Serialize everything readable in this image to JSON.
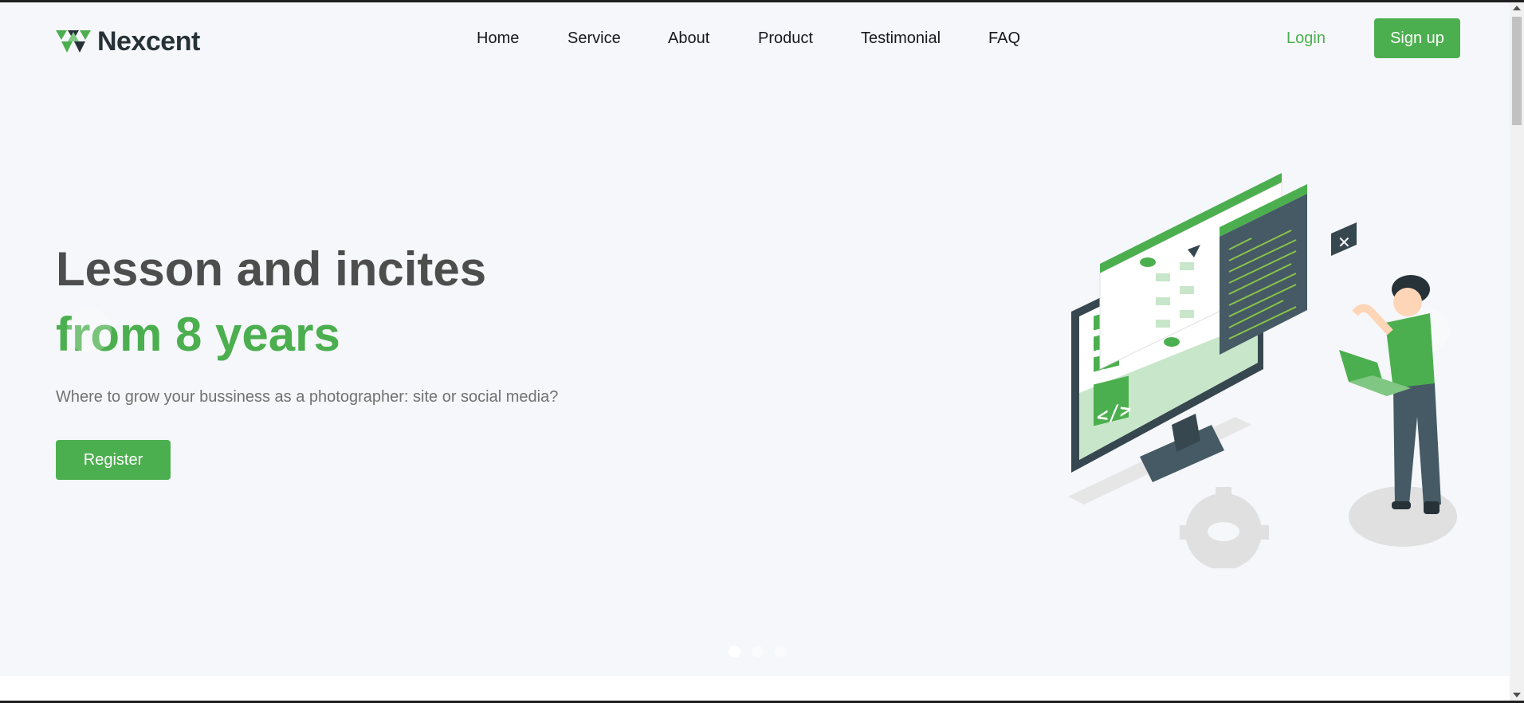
{
  "brand": {
    "name": "Nexcent",
    "logo_icon": "nexcent-triangles-logo",
    "color": "#4caf4f"
  },
  "nav": {
    "items": [
      {
        "label": "Home"
      },
      {
        "label": "Service"
      },
      {
        "label": "About"
      },
      {
        "label": "Product"
      },
      {
        "label": "Testimonial"
      },
      {
        "label": "FAQ"
      }
    ]
  },
  "auth": {
    "login_label": "Login",
    "signup_label": "Sign up"
  },
  "hero": {
    "title_line1": "Lesson and incites",
    "title_line2": "from 8 years",
    "subtitle": "Where to grow your bussiness as a photographer: site or social media?",
    "cta_label": "Register",
    "next_icon": "chevron-right-icon",
    "slides_total": 3,
    "active_slide": 1
  },
  "colors": {
    "accent": "#4caf4f",
    "heading": "#4d4d4d",
    "text": "#717171",
    "background": "#f5f7fa"
  }
}
